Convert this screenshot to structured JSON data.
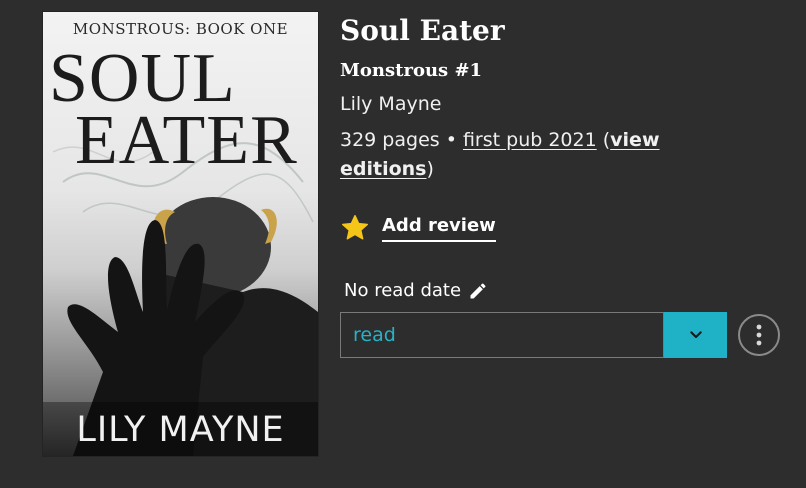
{
  "book": {
    "title": "Soul Eater",
    "series": "Monstrous #1",
    "author": "Lily Mayne",
    "pages": "329 pages",
    "separator": " • ",
    "first_pub": "first pub 2021",
    "view_editions_open": " (",
    "view_editions": "view editions",
    "view_editions_close": ")"
  },
  "cover": {
    "series_line": "MONSTROUS: BOOK ONE",
    "title_line1": "SOUL",
    "title_line2": "EATER",
    "author": "LILY MAYNE"
  },
  "review": {
    "icon": "star-icon",
    "label": "Add review",
    "star_color": "#f5c518"
  },
  "read_date": {
    "label": "No read date",
    "icon": "pencil-icon"
  },
  "status": {
    "value": "read",
    "accent": "#1fb1c6",
    "arrow_icon": "chevron-down-icon"
  },
  "more": {
    "icon": "vertical-dots-icon"
  }
}
